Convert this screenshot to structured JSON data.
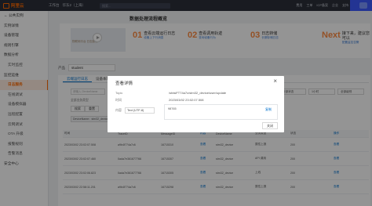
{
  "topbar": {
    "brand": "阿里云",
    "nav": [
      "工作台",
      "华东2（上海）"
    ],
    "search_placeholder": "搜索...",
    "right": [
      "费用",
      "工单",
      "ICP备案",
      "企业",
      "支持"
    ]
  },
  "sidebar": {
    "back": "← 公共实例",
    "items": [
      {
        "label": "实例详情"
      },
      {
        "label": "设备管理"
      },
      {
        "label": "规则引擎"
      },
      {
        "label": "数据分析"
      },
      {
        "label": "实时监控"
      },
      {
        "label": "监控运维"
      },
      {
        "label": "日志服务"
      },
      {
        "label": "在线调试"
      },
      {
        "label": "设备模拟器"
      },
      {
        "label": "远程配置"
      },
      {
        "label": "云网调试"
      },
      {
        "label": "OTA 升级"
      },
      {
        "label": "报警规则"
      },
      {
        "label": "告警消息"
      },
      {
        "label": "安全中心"
      }
    ]
  },
  "flow": {
    "title": "数据处理流程概览",
    "video_caption": "物联网平台 日志服务",
    "steps": [
      {
        "num": "01",
        "label": "查看云端运行日志",
        "sub": "设备上下行消息"
      },
      {
        "num": "02",
        "label": "查看调用轨迹",
        "sub": "查询设备行为"
      },
      {
        "num": "03",
        "label": "日志转储",
        "sub": "长期存储日志"
      },
      {
        "num": "Next",
        "label": "接下来，建议您可以",
        "sub": "配置监控告警"
      }
    ]
  },
  "filter": {
    "label": "产品",
    "value": "student"
  },
  "tabs": [
    "云端运行日志",
    "设备本地日志",
    "日志转储"
  ],
  "search_placeholder": "请输入 DeviceName",
  "filter_label": "全部业务类型",
  "buttons": {
    "search": "搜索",
    "reset": "重置"
  },
  "tag_text": "DeviceName：stm32_device",
  "right_controls": [
    "全部状态",
    "1小时",
    "全部级别"
  ],
  "table": {
    "headers": [
      "时间",
      "TraceID",
      "MessageID",
      "内容",
      "DeviceName",
      "业务类型",
      "状态",
      "操作"
    ],
    "rows": [
      [
        "2023/03/02 23:02:07.508",
        "a9b4f774a7c6",
        "16715310",
        "查看",
        "stm32_device",
        "属性上报",
        "200",
        "查看"
      ],
      [
        "2023/03/02 23:02:07.460",
        "0ada7e361677766",
        "16715307",
        "查看",
        "stm32_device",
        "API 调用",
        "200",
        "查看"
      ],
      [
        "2023/03/02 23:02:06.823",
        "0ada7e361677766",
        "16715305",
        "查看",
        "stm32_device",
        "上线",
        "200",
        "查看"
      ],
      [
        "2023/03/02 22:58:11.201",
        "a9b4f774a7c6",
        "16715298",
        "查看",
        "stm32_device",
        "属性上报",
        "200",
        "查看"
      ]
    ]
  },
  "modal": {
    "title": "查看详情",
    "close": "×",
    "topic_label": "Topic",
    "topic_value": "/sfdsiFT74a7c/stm32_device/user/update",
    "time_label": "时间",
    "time_value": "2023/03/02 23:02:07.508",
    "content_label": "内容",
    "encoding": "Text (UTF-8)",
    "content_value": "98765",
    "copy": "复制",
    "close_button": "关闭"
  },
  "colors": {
    "brand": "#ff6a00",
    "link": "#0070cc",
    "topbar": "#2b2f3a"
  }
}
